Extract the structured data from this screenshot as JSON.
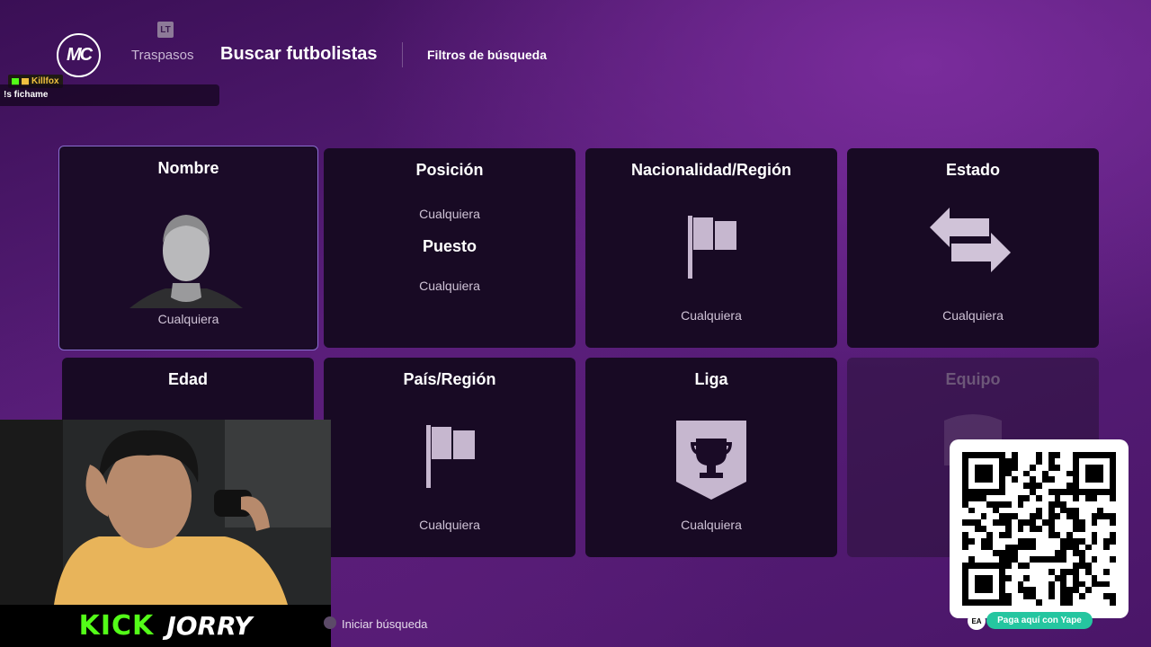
{
  "header": {
    "logo_text": "MC",
    "lt_icon_text": "LT",
    "tabs": [
      {
        "label": "Traspasos"
      },
      {
        "label": "Buscar futbolistas"
      }
    ],
    "filters_label": "Filtros de búsqueda"
  },
  "chat": {
    "username": "Killfox",
    "message": "!s fichame"
  },
  "tiles": {
    "nombre": {
      "title": "Nombre",
      "value": "Cualquiera"
    },
    "posicion": {
      "title": "Posición",
      "value": "Cualquiera",
      "subtitle": "Puesto",
      "subvalue": "Cualquiera"
    },
    "nacionalidad": {
      "title": "Nacionalidad/Región",
      "value": "Cualquiera"
    },
    "estado": {
      "title": "Estado",
      "value": "Cualquiera"
    },
    "edad": {
      "title": "Edad"
    },
    "pais": {
      "title": "País/Región",
      "value": "Cualquiera"
    },
    "liga": {
      "title": "Liga",
      "value": "Cualquiera"
    },
    "equipo": {
      "title": "Equipo"
    }
  },
  "footer": {
    "start_search_label": "Iniciar búsqueda"
  },
  "stream": {
    "platform_label": "KICK",
    "streamer_name": "JORRY",
    "qr_caption": "Paga aquí con Yape",
    "ea_badge": "EA"
  },
  "colors": {
    "accent_selected": "#8a6fd0",
    "kick_green": "#53fc18",
    "yape_teal": "#25c6a0"
  }
}
